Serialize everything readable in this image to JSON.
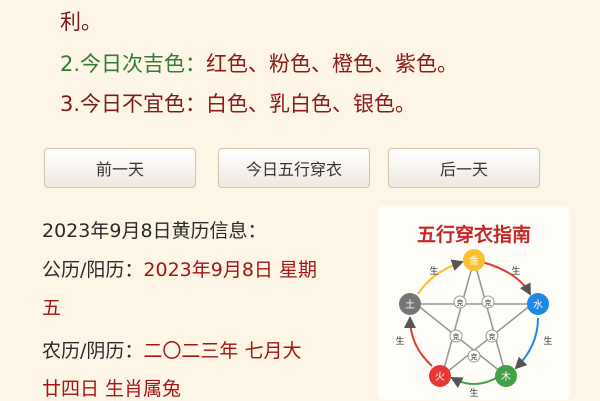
{
  "top": {
    "line1": "利。",
    "line2_label": "2.今日次吉色：",
    "line2_value": "红色、粉色、橙色、紫色。",
    "line3_label": "3.今日不宜色：",
    "line3_value": "白色、乳白色、银色。"
  },
  "nav": {
    "prev": "前一天",
    "today": "今日五行穿衣",
    "next": "后一天"
  },
  "almanac": {
    "heading": "2023年9月8日黄历信息：",
    "solar_label": "公历/阳历：",
    "solar_value": "2023年9月8日 星期",
    "solar_cont": "五",
    "lunar_label": "农历/阴历：",
    "lunar_value": "二〇二三年 七月大",
    "lunar_cont": "廿四日 生肖属兔"
  },
  "card": {
    "title": "五行穿衣指南",
    "nodes": {
      "fire": "火",
      "wood": "木",
      "water": "水",
      "earth": "土",
      "metal": "金"
    },
    "sheng": "生",
    "ke": "克",
    "colors": {
      "fire": "#e53935",
      "wood": "#43a047",
      "water": "#1e88e5",
      "earth": "#757575",
      "metal": "#fbc02d"
    }
  }
}
